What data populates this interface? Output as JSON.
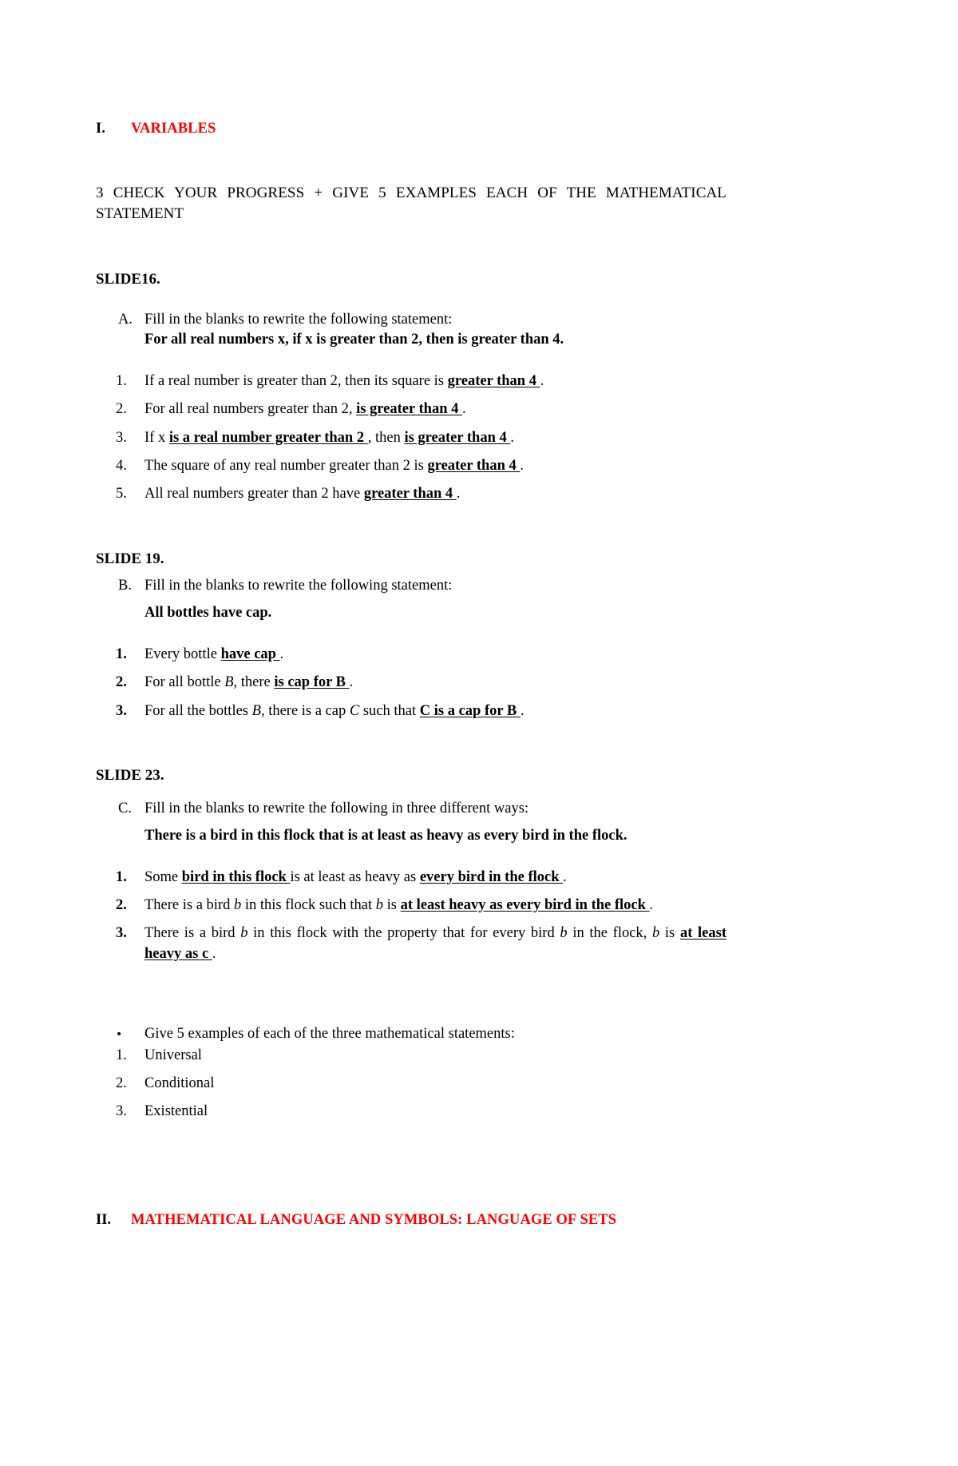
{
  "section_one": {
    "numeral": "I.",
    "label": "VARIABLES",
    "color": "#ff0000"
  },
  "intro": "3 CHECK YOUR PROGRESS + GIVE 5 EXAMPLES EACH OF THE MATHEMATICAL STATEMENT",
  "slide16": {
    "heading": "SLIDE16.",
    "item": {
      "marker": "A.",
      "prompt": "Fill in the blanks to rewrite the following statement:",
      "statement": "For all real numbers x, if x is greater than 2, then is greater than 4."
    },
    "answers": [
      {
        "marker": "1.",
        "pre": "If a real number is greater than 2, then its square is ",
        "blank1": " greater than 4 ",
        "mid": "",
        "blank2": "",
        "post": " ."
      },
      {
        "marker": "2.",
        "pre": "For all real numbers greater than 2, ",
        "blank1": " is greater than 4 ",
        "mid": "",
        "blank2": "",
        "post": "."
      },
      {
        "marker": "3.",
        "pre": "If x ",
        "blank1": " is a real number greater than 2 ",
        "mid": " , then ",
        "blank2": " is greater than 4 ",
        "post": " ."
      },
      {
        "marker": "4.",
        "pre": "The square of any real number greater than 2 is ",
        "blank1": " greater than 4 ",
        "mid": "",
        "blank2": "",
        "post": " ."
      },
      {
        "marker": "5.",
        "pre": "All real numbers greater than 2 have ",
        "blank1": " greater than 4 ",
        "mid": "",
        "blank2": "",
        "post": " ."
      }
    ]
  },
  "slide19": {
    "heading": "SLIDE 19.",
    "item": {
      "marker": "B.",
      "prompt": "Fill in the blanks to rewrite the following statement:",
      "statement": "All bottles have cap."
    },
    "answers": [
      {
        "marker": "1.",
        "pre": "Every bottle ",
        "blank": " have cap ",
        "post": " ."
      },
      {
        "marker": "2.",
        "pre_a": "For all bottle ",
        "var_a": "B",
        "pre_b": ", there ",
        "blank": " is cap for B ",
        "post": " ."
      },
      {
        "marker": "3.",
        "pre_a": "For all the bottles ",
        "var_a": "B",
        "pre_b": ", there is a cap ",
        "var_b": "C",
        "pre_c": " such that ",
        "blank": " C is a cap for B ",
        "post": " ."
      }
    ]
  },
  "slide23": {
    "heading": "SLIDE 23.",
    "item": {
      "marker": "C.",
      "prompt": "Fill in the blanks to rewrite the following in three different ways:",
      "statement": "There is a bird in this flock that is at least as heavy as every bird in the flock."
    },
    "answers": [
      {
        "marker": "1.",
        "pre": "Some ",
        "blank1": " bird in this flock ",
        "mid": " is at least as heavy as ",
        "blank2": " every bird in the flock ",
        "post": " ."
      },
      {
        "marker": "2.",
        "pre_a": "There is a bird ",
        "var_a": "b",
        "pre_b": " in this flock such that ",
        "var_b": "b",
        "pre_c": " is ",
        "blank1": " at least heavy as every bird in the flock ",
        "post": " ."
      },
      {
        "marker": "3.",
        "pre_a": "There is a bird ",
        "var_a": "b",
        "pre_b": " in this flock with the property that for every bird ",
        "var_b": "b",
        "pre_c": " in the flock, ",
        "var_c": "b",
        "pre_d": " is ",
        "blank1": " at least heavy as c ",
        "post": " ."
      }
    ]
  },
  "examples": {
    "bullet": {
      "marker": "•",
      "text": "Give 5 examples of each of the three mathematical statements:"
    },
    "items": [
      {
        "marker": "1.",
        "label": "Universal"
      },
      {
        "marker": "2.",
        "label": "Conditional"
      },
      {
        "marker": "3.",
        "label": "Existential"
      }
    ]
  },
  "section_two": {
    "numeral": "II.",
    "label": "MATHEMATICAL LANGUAGE AND SYMBOLS: LANGUAGE OF SETS",
    "color": "#ff0000"
  }
}
